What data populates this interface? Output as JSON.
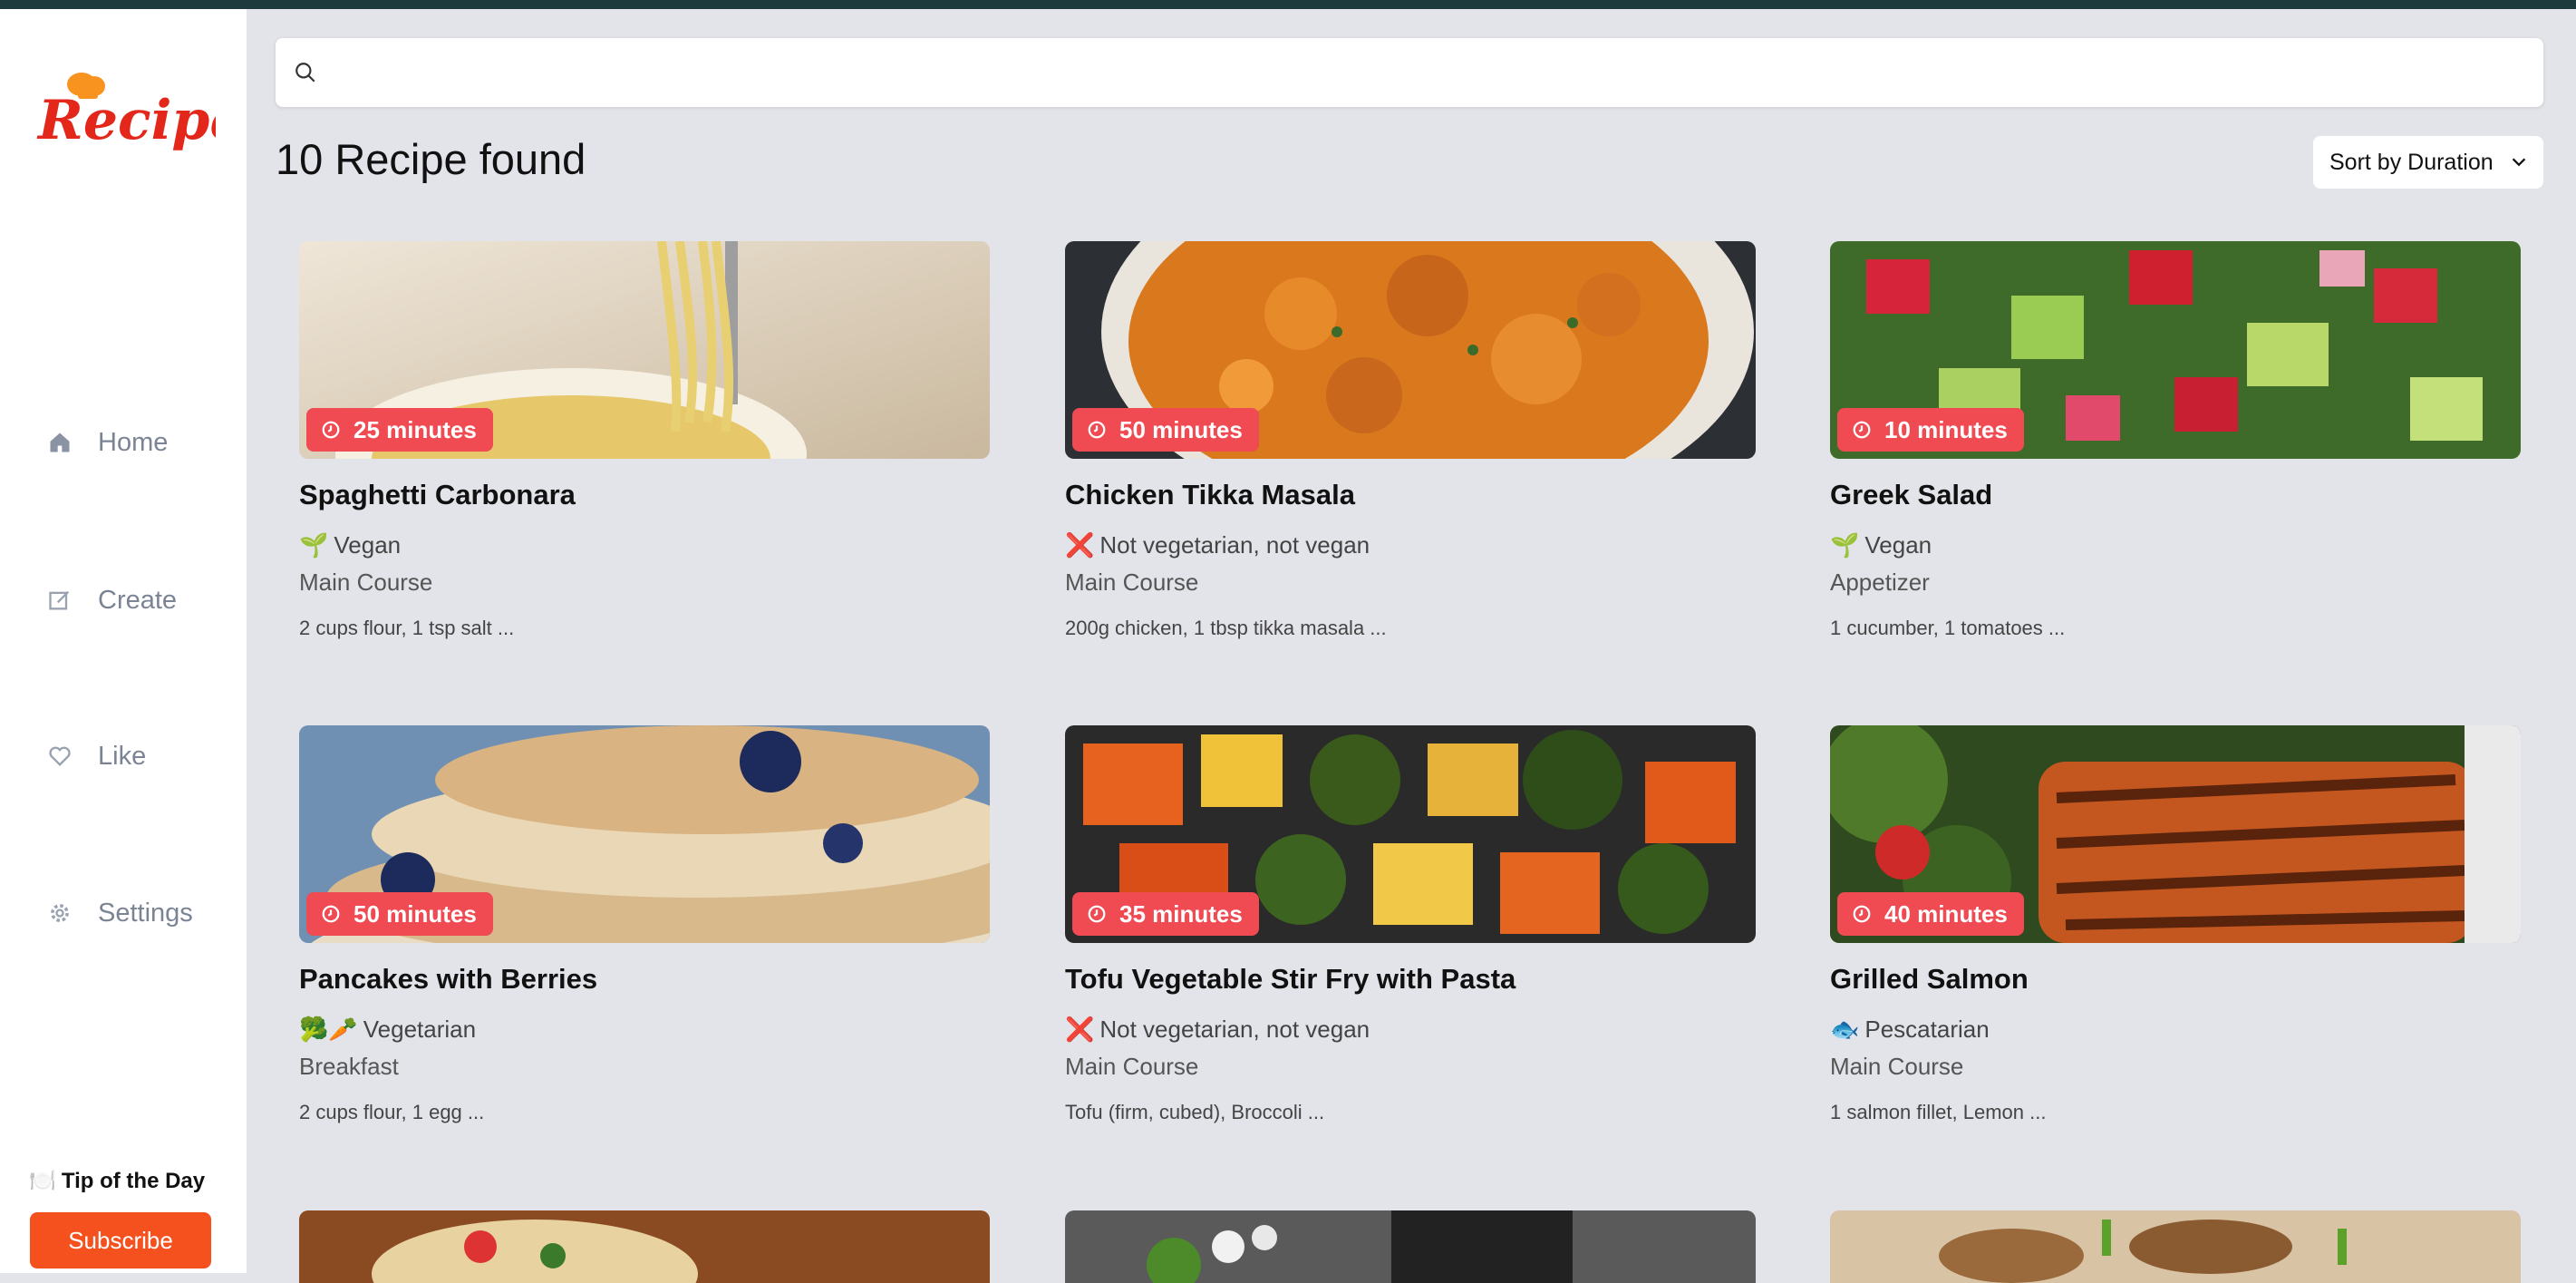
{
  "app": {
    "logo_text": "Recipes"
  },
  "sidebar": {
    "items": [
      {
        "label": "Home",
        "icon": "home-icon"
      },
      {
        "label": "Create",
        "icon": "edit-icon"
      },
      {
        "label": "Like",
        "icon": "heart-icon"
      },
      {
        "label": "Settings",
        "icon": "gear-icon"
      }
    ],
    "tip_label": "Tip of the Day",
    "tip_emoji": "🍽️",
    "subscribe_label": "Subscribe"
  },
  "search": {
    "placeholder": "",
    "value": ""
  },
  "results": {
    "title": "10 Recipe found"
  },
  "sort": {
    "label": "Sort by Duration"
  },
  "recipes": [
    {
      "title": "Spaghetti Carbonara",
      "duration": "25 minutes",
      "diet_emoji": "🌱",
      "diet": "Vegan",
      "course": "Main Course",
      "ingredients": "2 cups flour,  1 tsp salt  ..."
    },
    {
      "title": "Chicken Tikka Masala",
      "duration": "50 minutes",
      "diet_emoji": "❌",
      "diet": "Not vegetarian, not vegan",
      "course": "Main Course",
      "ingredients": "200g chicken,  1 tbsp tikka masala  ..."
    },
    {
      "title": "Greek Salad",
      "duration": "10 minutes",
      "diet_emoji": "🌱",
      "diet": "Vegan",
      "course": "Appetizer",
      "ingredients": "1 cucumber,  1 tomatoes  ..."
    },
    {
      "title": "Pancakes with Berries",
      "duration": "50 minutes",
      "diet_emoji": "🥦🥕",
      "diet": "Vegetarian",
      "course": "Breakfast",
      "ingredients": "2 cups flour,  1 egg  ..."
    },
    {
      "title": "Tofu Vegetable Stir Fry with Pasta",
      "duration": "35 minutes",
      "diet_emoji": "❌",
      "diet": "Not vegetarian, not vegan",
      "course": "Main Course",
      "ingredients": "Tofu (firm, cubed),  Broccoli  ..."
    },
    {
      "title": "Grilled Salmon",
      "duration": "40 minutes",
      "diet_emoji": "🐟",
      "diet": "Pescatarian",
      "course": "Main Course",
      "ingredients": "1 salmon fillet,  Lemon  ..."
    }
  ],
  "colors": {
    "accent": "#f4511e",
    "badge": "#f04a52",
    "background": "#e3e4ea",
    "topbar": "#1f3a3d"
  }
}
